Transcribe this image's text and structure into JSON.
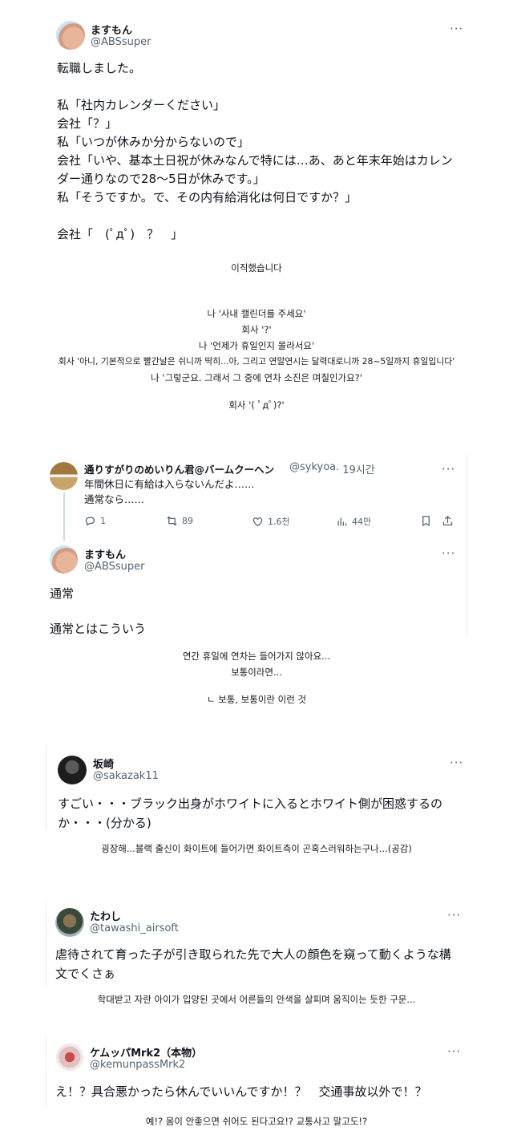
{
  "tweet1": {
    "name": "ますもん",
    "handle": "@ABSsuper",
    "lines": [
      "転職しました。",
      "",
      "私「社内カレンダーください」",
      "会社「？」",
      "私「いつが休みか分からないので」",
      "会社「いや、基本土日祝が休みなんで特には…あ、あと年末年始はカレン",
      "ダー通りなので28〜5日が休みです。」",
      "私「そうですか。で、その内有給消化は何日ですか？」",
      "",
      "会社「　(ﾟдﾟ)　？　」"
    ]
  },
  "translation1": {
    "title": "이직했습니다",
    "lines": [
      "나 '사내 캘린더를 주세요'",
      "회사 '?'",
      "나 '언제가 휴일인지 몰라서요'",
      "회사 '아니, 기본적으로 빨간날은 쉬니까 딱히...아, 그리고 연말연시는 달력대로니까 28~5일까지 휴일입니다'",
      "나 '그렇군요. 그래서 그 중에 연차 소진은 며칠인가요?'",
      "",
      "회사 '( ﾟдﾟ)?'"
    ]
  },
  "reply1": {
    "name": "通りすがりのめいりん君@バームクーヘン",
    "handle": "@sykyoa",
    "time": "· 19시간",
    "lines": [
      "年間休日に有給は入らないんだよ……",
      "通常なら……"
    ],
    "stats": {
      "replies": "1",
      "retweets": "89",
      "likes": "1.6천",
      "views": "44만"
    }
  },
  "reply2": {
    "name": "ますもん",
    "handle": "@ABSsuper",
    "lines": [
      "通常",
      "",
      "通常とはこういう"
    ]
  },
  "translation2": {
    "lines": [
      "연간 휴일에 연차는 들어가지 않아요...",
      "보통이라면...",
      "",
      "ㄴ 보통, 보통이란 이런 것"
    ]
  },
  "tweet3": {
    "name": "坂崎",
    "handle": "@sakazak11",
    "lines": [
      "すごい・・・ブラック出身がホワイトに入るとホワイト側が困惑するの",
      "か・・・(分かる)"
    ],
    "translation": "굉장해...블랙 출신이 화이트에 들어가면 화이트측이 곤혹스러워하는구나...(공감)"
  },
  "tweet4": {
    "name": "たわし",
    "handle": "@tawashi_airsoft",
    "lines": [
      "虐待されて育った子が引き取られた先で大人の顔色を窺って動くような構",
      "文でくさぁ"
    ],
    "translation": "학대받고 자란 아이가 입양된 곳에서 어른들의 안색을 살피며 움직이는 듯한 구문..."
  },
  "tweet5": {
    "name": "ケムッパMrk2（本物）",
    "handle": "@kemunpassMrk2",
    "lines": [
      "え！？具合悪かったら休んでいいんですか！？　交通事故以外で！？"
    ],
    "translation": "예!? 몸이 안좋으면 쉬어도 된다고요!? 교통사고 말고도!?"
  },
  "more_label": "···",
  "colors": {
    "text": "#0f1419",
    "secondary": "#536471",
    "divider": "#cfd9de"
  }
}
